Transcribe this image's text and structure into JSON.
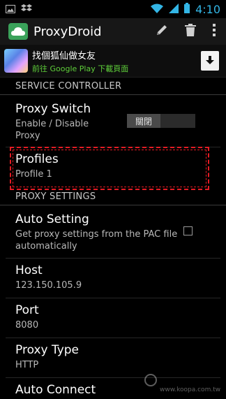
{
  "status_bar": {
    "time": "4:10",
    "left_icons": [
      "photo-icon",
      "dropbox-icon"
    ],
    "right_icons": [
      "wifi-icon",
      "signal-icon",
      "battery-icon"
    ]
  },
  "action_bar": {
    "title": "ProxyDroid",
    "actions": [
      "pencil-icon",
      "trash-icon",
      "overflow-menu-icon"
    ]
  },
  "ad": {
    "title": "找個狐仙做女友",
    "subtitle": "前往 Google Play 下載頁面"
  },
  "sections": {
    "service_controller": "SERVICE CONTROLLER",
    "proxy_settings": "PROXY SETTINGS"
  },
  "prefs": {
    "proxy_switch": {
      "title": "Proxy Switch",
      "summary": "Enable / Disable Proxy",
      "toggle_label": "關閉"
    },
    "profiles": {
      "title": "Profiles",
      "summary": "Profile 1"
    },
    "auto_setting": {
      "title": "Auto Setting",
      "summary": "Get proxy settings from the PAC file automatically",
      "checked": false
    },
    "host": {
      "title": "Host",
      "summary": "123.150.105.9"
    },
    "port": {
      "title": "Port",
      "summary": "8080"
    },
    "proxy_type": {
      "title": "Proxy Type",
      "summary": "HTTP"
    },
    "auto_connect": {
      "title": "Auto Connect"
    }
  },
  "watermark": {
    "url": "www.koopa.com.tw"
  },
  "colors": {
    "accent": "#33b5e5",
    "highlight": "#e31b23",
    "ad_link": "#5fcf3a",
    "app_icon": "#3aa25a"
  }
}
